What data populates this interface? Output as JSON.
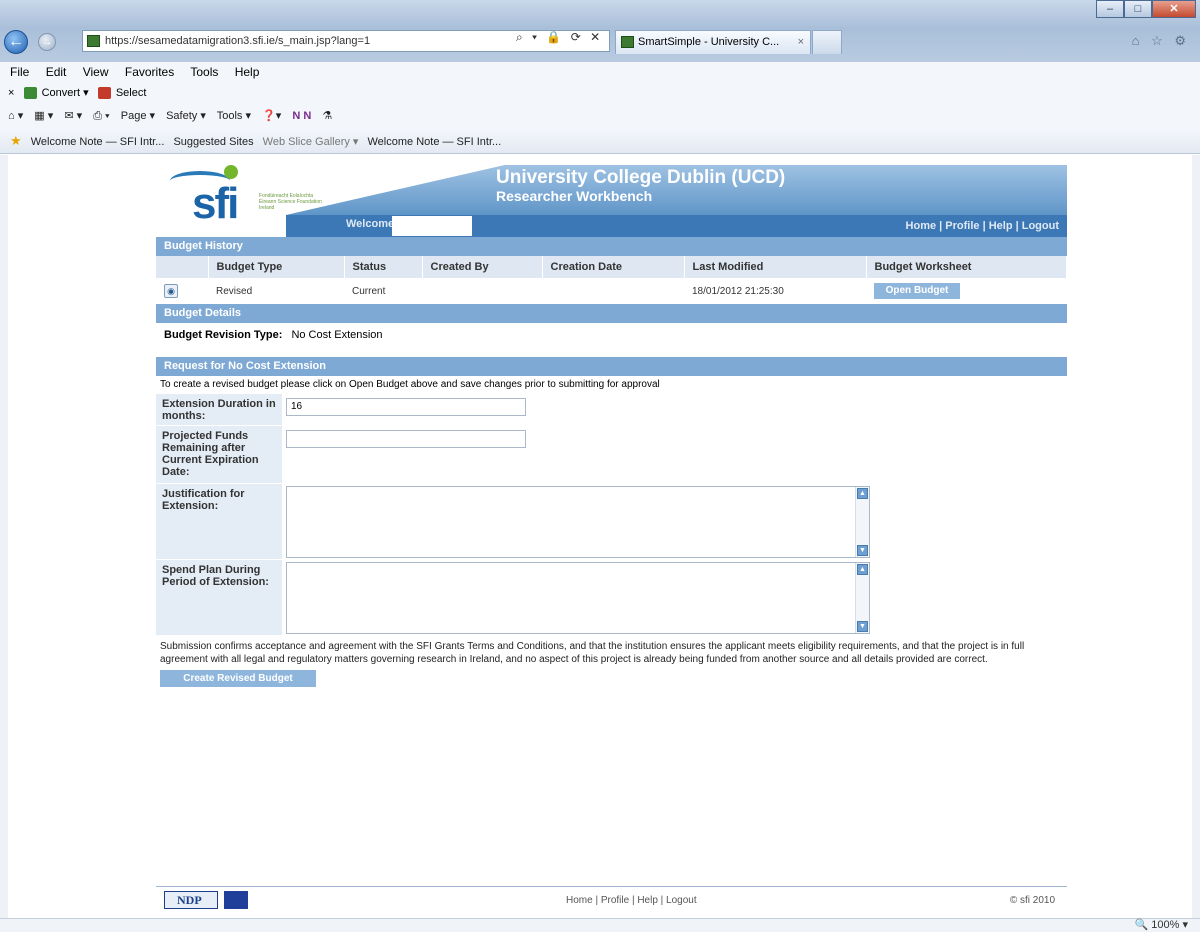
{
  "browser": {
    "address": "https://sesamedatamigration3.sfi.ie/s_main.jsp?lang=1",
    "address_icons": "⌕ ▾ 🔒 ⟳ ✕",
    "tab_title": "SmartSimple - University C...",
    "tab_close": "×",
    "menu": [
      "File",
      "Edit",
      "View",
      "Favorites",
      "Tools",
      "Help"
    ],
    "convert_row": [
      "×",
      "Convert",
      "▾",
      "Select"
    ],
    "command_bar": [
      "Page ▾",
      "Safety ▾",
      "Tools ▾"
    ],
    "favorites": [
      {
        "label": "Welcome Note — SFI Intr...",
        "dim": false
      },
      {
        "label": "Suggested Sites",
        "dim": false
      },
      {
        "label": "Web Slice Gallery ▾",
        "dim": true
      },
      {
        "label": "Welcome Note — SFI Intr...",
        "dim": false
      }
    ],
    "zoom": "100%"
  },
  "header": {
    "title": "University College Dublin (UCD)",
    "subtitle": "Researcher Workbench",
    "welcome": "Welcome",
    "links": "Home | Profile | Help | Logout",
    "logo_text": "sfi",
    "logo_tagline": "Fondúireacht Eolaíochta Éireann Science Foundation Ireland"
  },
  "budget_history": {
    "heading": "Budget History",
    "columns": [
      "Budget Type",
      "Status",
      "Created By",
      "Creation Date",
      "Last Modified",
      "Budget Worksheet"
    ],
    "rows": [
      {
        "type": "Revised",
        "status": "Current",
        "created_by": "",
        "creation_date": "",
        "last_modified": "18/01/2012 21:25:30",
        "action": "Open Budget"
      }
    ]
  },
  "budget_details": {
    "heading": "Budget Details",
    "label": "Budget Revision Type:",
    "value": "No Cost Extension"
  },
  "request": {
    "heading": "Request for No Cost Extension",
    "instruction": "To create a revised budget please click on Open Budget above and save changes prior to submitting for approval",
    "fields": {
      "duration_label": "Extension Duration in months:",
      "duration_value": "16",
      "funds_label": "Projected Funds Remaining after Current Expiration Date:",
      "funds_value": "",
      "justification_label": "Justification for Extension:",
      "spend_label": "Spend Plan During Period of Extension:"
    },
    "terms": "Submission confirms acceptance and agreement with the SFI Grants Terms and Conditions, and that the institution ensures the applicant meets eligibility requirements, and that the project is in full agreement with all legal and regulatory matters governing research in Ireland, and no aspect of this project is already being funded from another source and all details provided are correct.",
    "submit_label": "Create Revised Budget"
  },
  "footer": {
    "ndp": "NDP",
    "links": "Home | Profile | Help | Logout",
    "copyright": "© sfi 2010"
  },
  "colors": {
    "section_bar": "#7ea9d4",
    "header_bar": "#3d78b6",
    "label_bg": "#e4ecf5"
  }
}
